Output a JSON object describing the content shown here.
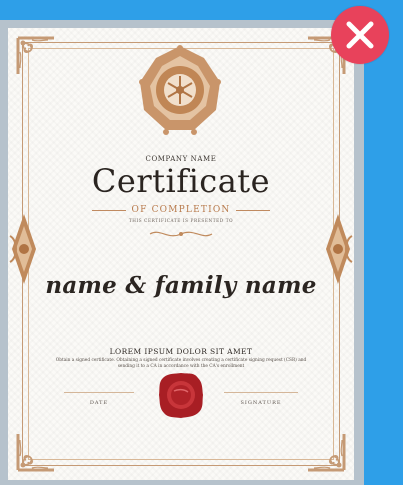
{
  "certificate": {
    "company_name": "COMPANY NAME",
    "title": "Certificate",
    "subtitle": "OF COMPLETION",
    "presented_line": "THIS CERTIFICATE IS PRESENTED TO",
    "recipient": "name & family name",
    "heading": "LOREM IPSUM DOLOR SIT AMET",
    "body": "Obtain a signed certificate. Obtaining a signed certificate involves creating a certificate signing request (CSR) and sending it to a CA in accordance with the CA's enrollment",
    "date_label": "DATE",
    "signature_label": "SIGNATURE"
  },
  "colors": {
    "background": "#2e9fe8",
    "frame": "#b6c2cc",
    "ornament": "#c59a75",
    "seal": "#a81e24",
    "close_button": "#e8425b"
  },
  "icons": {
    "close": "close-icon",
    "seal": "wax-seal-icon"
  }
}
